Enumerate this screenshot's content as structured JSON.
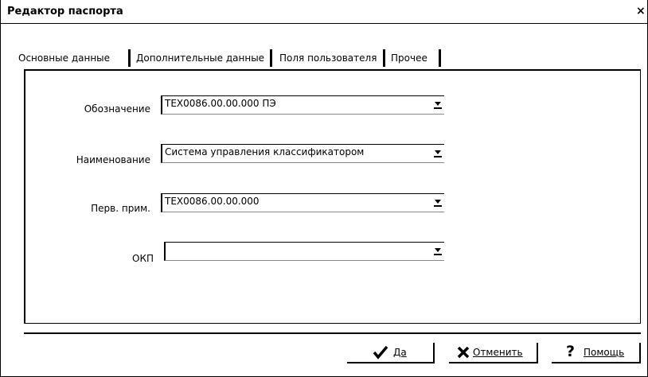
{
  "window": {
    "title": "Редактор паспорта",
    "close_glyph": "×"
  },
  "tabs": [
    {
      "label": "Основные данные",
      "selected": true
    },
    {
      "label": "Дополнительные данные"
    },
    {
      "label": "Поля пользователя"
    },
    {
      "label": "Прочее"
    }
  ],
  "fields": {
    "designation": {
      "label": "Обозначение",
      "value": "ТЕХ0086.00.00.000  ПЭ"
    },
    "name": {
      "label": "Наименование",
      "value": "Система управления классификатором"
    },
    "first_use": {
      "label": "Перв. прим.",
      "value": "ТЕХ0086.00.00.000"
    },
    "okp": {
      "label": "ОКП",
      "value": ""
    }
  },
  "buttons": {
    "ok": {
      "label": "Да",
      "icon": "checkmark-icon"
    },
    "cancel": {
      "label": "Отменить",
      "icon": "cross-icon"
    },
    "help": {
      "label": "Помощь",
      "icon": "question-icon"
    }
  }
}
